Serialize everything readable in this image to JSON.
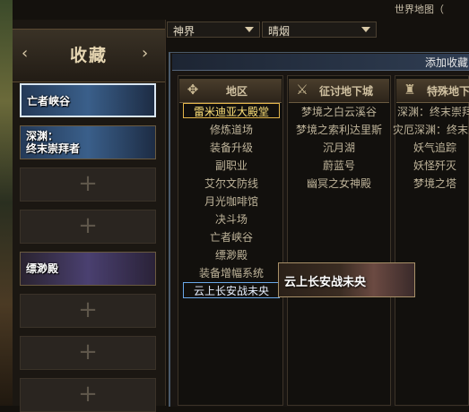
{
  "window": {
    "title": "世界地图（"
  },
  "filters": {
    "world": "神界",
    "region": "晴烟"
  },
  "favorites": {
    "title": "收藏",
    "slots": [
      {
        "label": "亡者峡谷",
        "filled": true,
        "selected": true
      },
      {
        "label": "深渊：\n终末崇拜者",
        "filled": true,
        "selected": false
      },
      {
        "label": "",
        "filled": false
      },
      {
        "label": "",
        "filled": false
      },
      {
        "label": "缥渺殿",
        "filled": true,
        "selected": false
      },
      {
        "label": "",
        "filled": false
      },
      {
        "label": "",
        "filled": false
      },
      {
        "label": "",
        "filled": false
      }
    ],
    "plus_symbol": "+"
  },
  "dialog": {
    "title": "添加收藏",
    "columns": [
      {
        "header": "地区",
        "items": [
          "雷米迪亚大殿堂",
          "修炼道场",
          "装备升级",
          "副职业",
          "艾尔文防线",
          "月光咖啡馆",
          "决斗场",
          "亡者峡谷",
          "缥渺殿",
          "装备增幅系统",
          "云上长安战未央"
        ]
      },
      {
        "header": "征讨地下城",
        "items": [
          "梦境之白云溪谷",
          "梦境之索利达里斯",
          "沉月湖",
          "蔚蓝号",
          "幽冥之女神殿"
        ]
      },
      {
        "header": "特殊地下",
        "items": [
          "深渊：终末崇拜",
          "灾厄深渊：终末崇",
          "妖气追踪",
          "妖怪歼灭",
          "梦境之塔"
        ]
      }
    ],
    "selected_item": "雷米迪亚大殿堂",
    "hovered_item": "云上长安战未央"
  },
  "tooltip": {
    "text": "云上长安战未央"
  }
}
